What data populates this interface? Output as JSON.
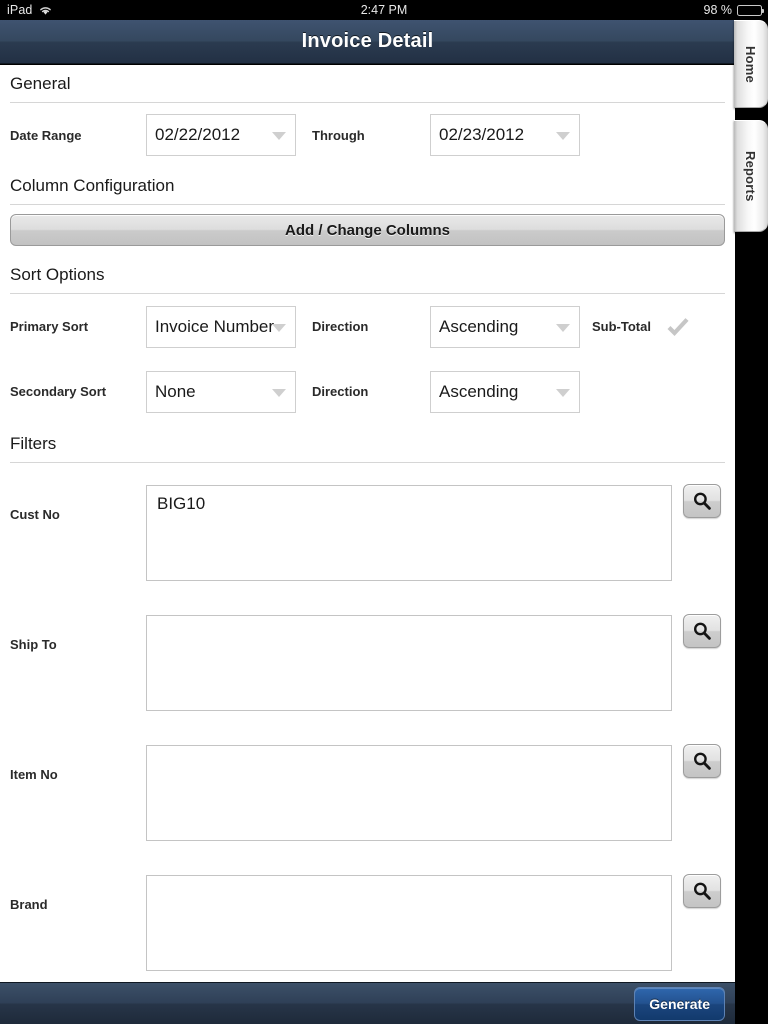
{
  "status_bar": {
    "device": "iPad",
    "wifi_icon": "wifi-icon",
    "time": "2:47 PM",
    "battery_percent": "98 %",
    "battery_icon": "battery-icon"
  },
  "nav": {
    "title": "Invoice Detail"
  },
  "side_tabs": [
    {
      "label": "Home",
      "name": "side-tab-home"
    },
    {
      "label": "Reports",
      "name": "side-tab-reports"
    }
  ],
  "sections": {
    "general": {
      "header": "General",
      "date_range_label": "Date Range",
      "date_from": "02/22/2012",
      "through_label": "Through",
      "date_to": "02/23/2012"
    },
    "column_configuration": {
      "header": "Column Configuration",
      "button_label": "Add / Change Columns"
    },
    "sort_options": {
      "header": "Sort Options",
      "primary_sort_label": "Primary Sort",
      "primary_sort_value": "Invoice Number",
      "primary_direction_label": "Direction",
      "primary_direction_value": "Ascending",
      "sub_total_label": "Sub-Total",
      "sub_total_checkmark": "checkmark-icon",
      "secondary_sort_label": "Secondary Sort",
      "secondary_sort_value": "None",
      "secondary_direction_label": "Direction",
      "secondary_direction_value": "Ascending"
    },
    "filters": {
      "header": "Filters",
      "rows": [
        {
          "label": "Cust No",
          "value": "BIG10",
          "search_icon": "search-icon"
        },
        {
          "label": "Ship To",
          "value": "",
          "search_icon": "search-icon"
        },
        {
          "label": "Item No",
          "value": "",
          "search_icon": "search-icon"
        },
        {
          "label": "Brand",
          "value": "",
          "search_icon": "search-icon"
        }
      ]
    }
  },
  "bottom_bar": {
    "generate_label": "Generate"
  },
  "colors": {
    "nav_bar": "#2b3b50",
    "generate_button": "#1b457d",
    "checkmark_gray": "#c6c6c6",
    "page_background": "#ffffff"
  }
}
